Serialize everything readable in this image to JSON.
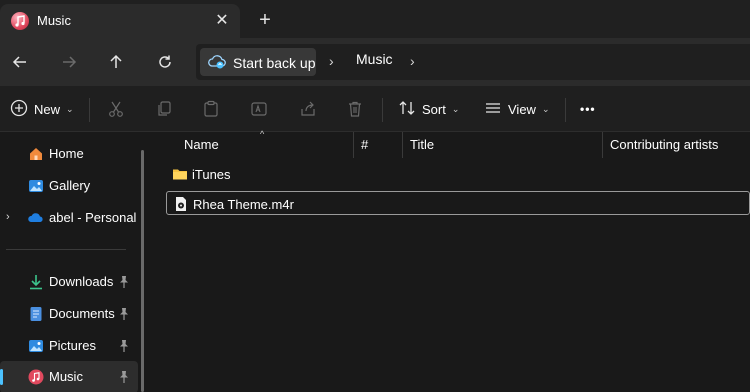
{
  "tab": {
    "title": "Music",
    "close_symbol": "✕",
    "new_tab_symbol": "+"
  },
  "address": {
    "start_backup": "Start back up",
    "crumbs": [
      "Music"
    ],
    "separator": "›"
  },
  "commands": {
    "new": "New",
    "sort": "Sort",
    "view": "View",
    "more": "•••"
  },
  "sidebar": {
    "items": [
      {
        "label": "Home",
        "icon": "home-icon"
      },
      {
        "label": "Gallery",
        "icon": "gallery-icon"
      },
      {
        "label": "abel - Personal",
        "icon": "onedrive-icon",
        "expand": "›"
      },
      {
        "label": "Downloads",
        "icon": "downloads-icon",
        "pinned": true
      },
      {
        "label": "Documents",
        "icon": "documents-icon",
        "pinned": true
      },
      {
        "label": "Pictures",
        "icon": "pictures-icon",
        "pinned": true
      },
      {
        "label": "Music",
        "icon": "music-icon",
        "pinned": true,
        "selected": true
      }
    ]
  },
  "columns": {
    "name": "Name",
    "number": "#",
    "title": "Title",
    "artists": "Contributing artists",
    "sort_indicator": "^"
  },
  "files": [
    {
      "name": "iTunes",
      "type": "folder"
    },
    {
      "name": "Rhea Theme.m4r",
      "type": "audio-file"
    }
  ],
  "colors": {
    "accent": "#4cc2ff",
    "folder": "#f5c242",
    "background": "#191919",
    "toolbar": "#2b2b2b"
  }
}
